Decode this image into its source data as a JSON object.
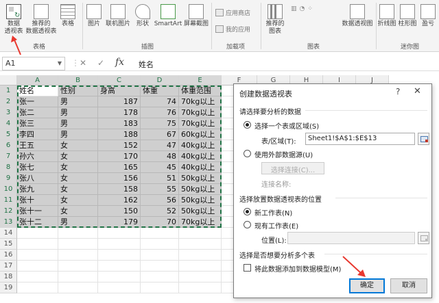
{
  "ribbon": {
    "groups": {
      "tables": "表格",
      "illustrations": "插图",
      "addins": "加载项",
      "charts": "图表",
      "sparklines": "迷你图"
    },
    "pivot_table": "数据\n透视表",
    "recommended_pivot": "推荐的\n数据透视表",
    "table": "表格",
    "picture": "图片",
    "online_picture": "联机图片",
    "shapes": "形状",
    "smartart": "SmartArt",
    "screenshot": "屏幕截图",
    "store": "应用商店",
    "my_addins": "我的应用",
    "recommended_charts": "推荐的\n图表",
    "pivot_chart": "数据透视图",
    "line": "折线图",
    "column": "柱形图",
    "winloss": "盈亏"
  },
  "formula_bar": {
    "name_box": "A1",
    "content": "姓名"
  },
  "columns": [
    "A",
    "B",
    "C",
    "D",
    "E",
    "F",
    "G",
    "H",
    "I",
    "J"
  ],
  "rows": [
    "1",
    "2",
    "3",
    "4",
    "5",
    "6",
    "7",
    "8",
    "9",
    "10",
    "11",
    "12",
    "13",
    "14",
    "15",
    "16",
    "17",
    "18",
    "19"
  ],
  "table": {
    "headers": [
      "姓名",
      "性别",
      "身高",
      "体重",
      "体重范围"
    ],
    "rows": [
      [
        "张一",
        "男",
        "187",
        "74",
        "70kg以上"
      ],
      [
        "张二",
        "男",
        "178",
        "76",
        "70kg以上"
      ],
      [
        "张三",
        "男",
        "183",
        "75",
        "70kg以上"
      ],
      [
        "李四",
        "男",
        "188",
        "67",
        "60kg以上"
      ],
      [
        "王五",
        "女",
        "152",
        "47",
        "40kg以上"
      ],
      [
        "孙六",
        "女",
        "170",
        "48",
        "40kg以上"
      ],
      [
        "张七",
        "女",
        "165",
        "45",
        "40kg以上"
      ],
      [
        "张八",
        "女",
        "156",
        "51",
        "50kg以上"
      ],
      [
        "张九",
        "女",
        "158",
        "55",
        "50kg以上"
      ],
      [
        "张十",
        "女",
        "162",
        "56",
        "50kg以上"
      ],
      [
        "张十一",
        "女",
        "150",
        "52",
        "50kg以上"
      ],
      [
        "张十二",
        "男",
        "179",
        "70",
        "70kg以上"
      ]
    ]
  },
  "dialog": {
    "title": "创建数据透视表",
    "help": "?",
    "close": "✕",
    "section1": "请选择要分析的数据",
    "opt_range": "选择一个表或区域(S)",
    "range_label": "表/区域(T):",
    "range_value": "Sheet1!$A$1:$E$13",
    "opt_external": "使用外部数据源(U)",
    "choose_conn": "选择连接(C)...",
    "conn_name": "连接名称:",
    "section2": "选择放置数据透视表的位置",
    "opt_new": "新工作表(N)",
    "opt_existing": "现有工作表(E)",
    "location_label": "位置(L):",
    "section3": "选择是否想要分析多个表",
    "add_model": "将此数据添加到数据模型(M)",
    "ok": "确定",
    "cancel": "取消"
  },
  "colors": {
    "accent_green": "#217346",
    "arrow_red": "#e8382f",
    "selection_gray": "#cfcfcf"
  }
}
